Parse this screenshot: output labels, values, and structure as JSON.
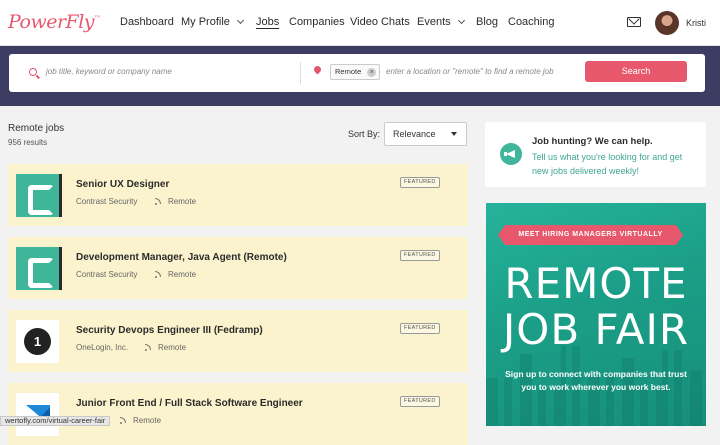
{
  "nav": {
    "logo": "PowerFly",
    "logo_mark": "™",
    "items": [
      {
        "label": "Dashboard",
        "dropdown": false,
        "active": false
      },
      {
        "label": "My Profile",
        "dropdown": true,
        "active": false
      },
      {
        "label": "Jobs",
        "dropdown": false,
        "active": true
      },
      {
        "label": "Companies",
        "dropdown": false,
        "active": false
      },
      {
        "label": "Video Chats",
        "dropdown": false,
        "active": false
      },
      {
        "label": "Events",
        "dropdown": true,
        "active": false
      },
      {
        "label": "Blog",
        "dropdown": false,
        "active": false
      },
      {
        "label": "Coaching",
        "dropdown": false,
        "active": false
      }
    ],
    "mail_icon": "envelope-icon",
    "username": "Kristi"
  },
  "search": {
    "keyword_placeholder": "job title, keyword or company name",
    "location_chip": "Remote",
    "chip_remove": "×",
    "location_placeholder": "enter a location or \"remote\" to find a remote job",
    "button": "Search"
  },
  "results": {
    "title": "Remote jobs",
    "count": "956 results",
    "sort_label": "Sort By:",
    "sort_value": "Relevance"
  },
  "jobs": [
    {
      "title": "Senior UX Designer",
      "company": "Contrast Security",
      "location": "Remote",
      "badge": "FEATURED",
      "logo": "contrast-security-logo"
    },
    {
      "title": "Development Manager, Java Agent (Remote)",
      "company": "Contrast Security",
      "location": "Remote",
      "badge": "FEATURED",
      "logo": "contrast-security-logo"
    },
    {
      "title": "Security Devops Engineer III (Fedramp)",
      "company": "OneLogin, Inc.",
      "location": "Remote",
      "badge": "FEATURED",
      "logo": "onelogin-logo"
    },
    {
      "title": "Junior Front End / Full Stack Software Engineer",
      "company": "",
      "location": "Remote",
      "badge": "FEATURED",
      "logo": "blue-triangle-logo"
    }
  ],
  "status_url": "wertofly.com/virtual-career-fair",
  "sidebar": {
    "help_title": "Job hunting? We can help.",
    "help_text": "Tell us what you're looking for and get new jobs delivered weekly!",
    "ad": {
      "banner": "MEET HIRING MANAGERS VIRTUALLY",
      "headline_1": "REMOTE",
      "headline_2": "JOB FAIR",
      "subtext": "Sign up to connect with companies that trust you to work wherever you work best."
    }
  },
  "colors": {
    "brand_pink": "#e8586d",
    "header_band": "#3d3c63",
    "featured_bg": "#fbf3cd",
    "teal": "#3fb69a"
  }
}
